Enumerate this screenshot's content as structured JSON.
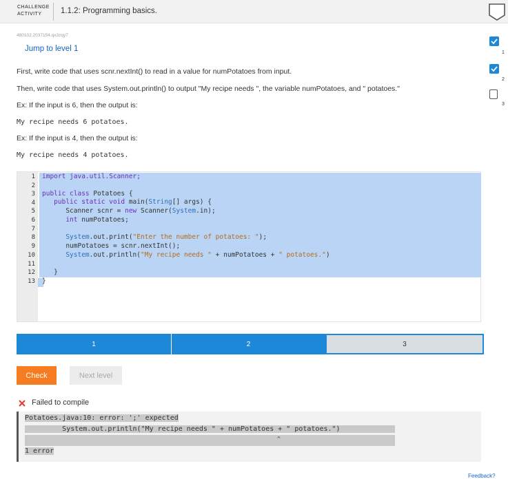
{
  "header": {
    "label_line1": "CHALLENGE",
    "label_line2": "ACTIVITY",
    "title": "1.1.2: Programming basics."
  },
  "progress": {
    "steps": [
      {
        "num": "1",
        "status": "done"
      },
      {
        "num": "2",
        "status": "done"
      },
      {
        "num": "3",
        "status": "todo"
      }
    ]
  },
  "meta": {
    "id": "480102.2037154.qx3zqy7",
    "jump_link": "Jump to level 1"
  },
  "instructions": {
    "line1": "First, write code that uses scnr.nextInt() to read in a value for numPotatoes from input.",
    "line2": "Then, write code that uses System.out.println() to output \"My recipe needs \", the variable numPotatoes, and \" potatoes.\"",
    "ex1": "Ex: If the input is 6, then the output is:",
    "out1": "My recipe needs 6 potatoes.",
    "ex2": "Ex: If the input is 4, then the output is:",
    "out2": "My recipe needs 4 potatoes."
  },
  "editor": {
    "line_numbers": [
      "1",
      "2",
      "3",
      "4",
      "5",
      "6",
      "7",
      "8",
      "9",
      "10",
      "11",
      "12",
      "13"
    ],
    "code": {
      "l1": "import java.util.Scanner;",
      "l3a": "public class",
      "l3b": " Potatoes {",
      "l4a": "   public static void",
      "l4b": " main(",
      "l4c": "String",
      "l4d": "[] args) {",
      "l5a": "      Scanner scnr = ",
      "l5b": "new",
      "l5c": " Scanner(",
      "l5d": "System",
      "l5e": ".in);",
      "l6a": "      int",
      "l6b": " numPotatoes;",
      "l8a": "      System",
      "l8b": ".out.print(",
      "l8c": "\"Enter the number of potatoes: \"",
      "l8d": ");",
      "l9": "      numPotatoes = scnr.nextInt();",
      "l10a": "      System",
      "l10b": ".out.println(",
      "l10c": "\"My recipe needs \"",
      "l10d": " + numPotatoes + ",
      "l10e": "\" potatoes.\"",
      "l10f": ")",
      "l12": "   }",
      "l13": "}"
    }
  },
  "levels": [
    {
      "label": "1",
      "state": "current"
    },
    {
      "label": "2",
      "state": "current"
    },
    {
      "label": "3",
      "state": "locked"
    }
  ],
  "buttons": {
    "check": "Check",
    "next": "Next level"
  },
  "result": {
    "status": "Failed to compile",
    "output": [
      "Potatoes.java:10: error: ';' expected",
      "         System.out.println(\"My recipe needs \" + numPotatoes + \" potatoes.\")",
      "                                                                            ^",
      "1 error"
    ]
  },
  "footer": {
    "feedback": "Feedback?"
  },
  "colors": {
    "accent": "#1e88d8",
    "check_button": "#f57c20",
    "link": "#1565c0",
    "selection": "#b9d4f4",
    "error_icon": "#e53935"
  }
}
